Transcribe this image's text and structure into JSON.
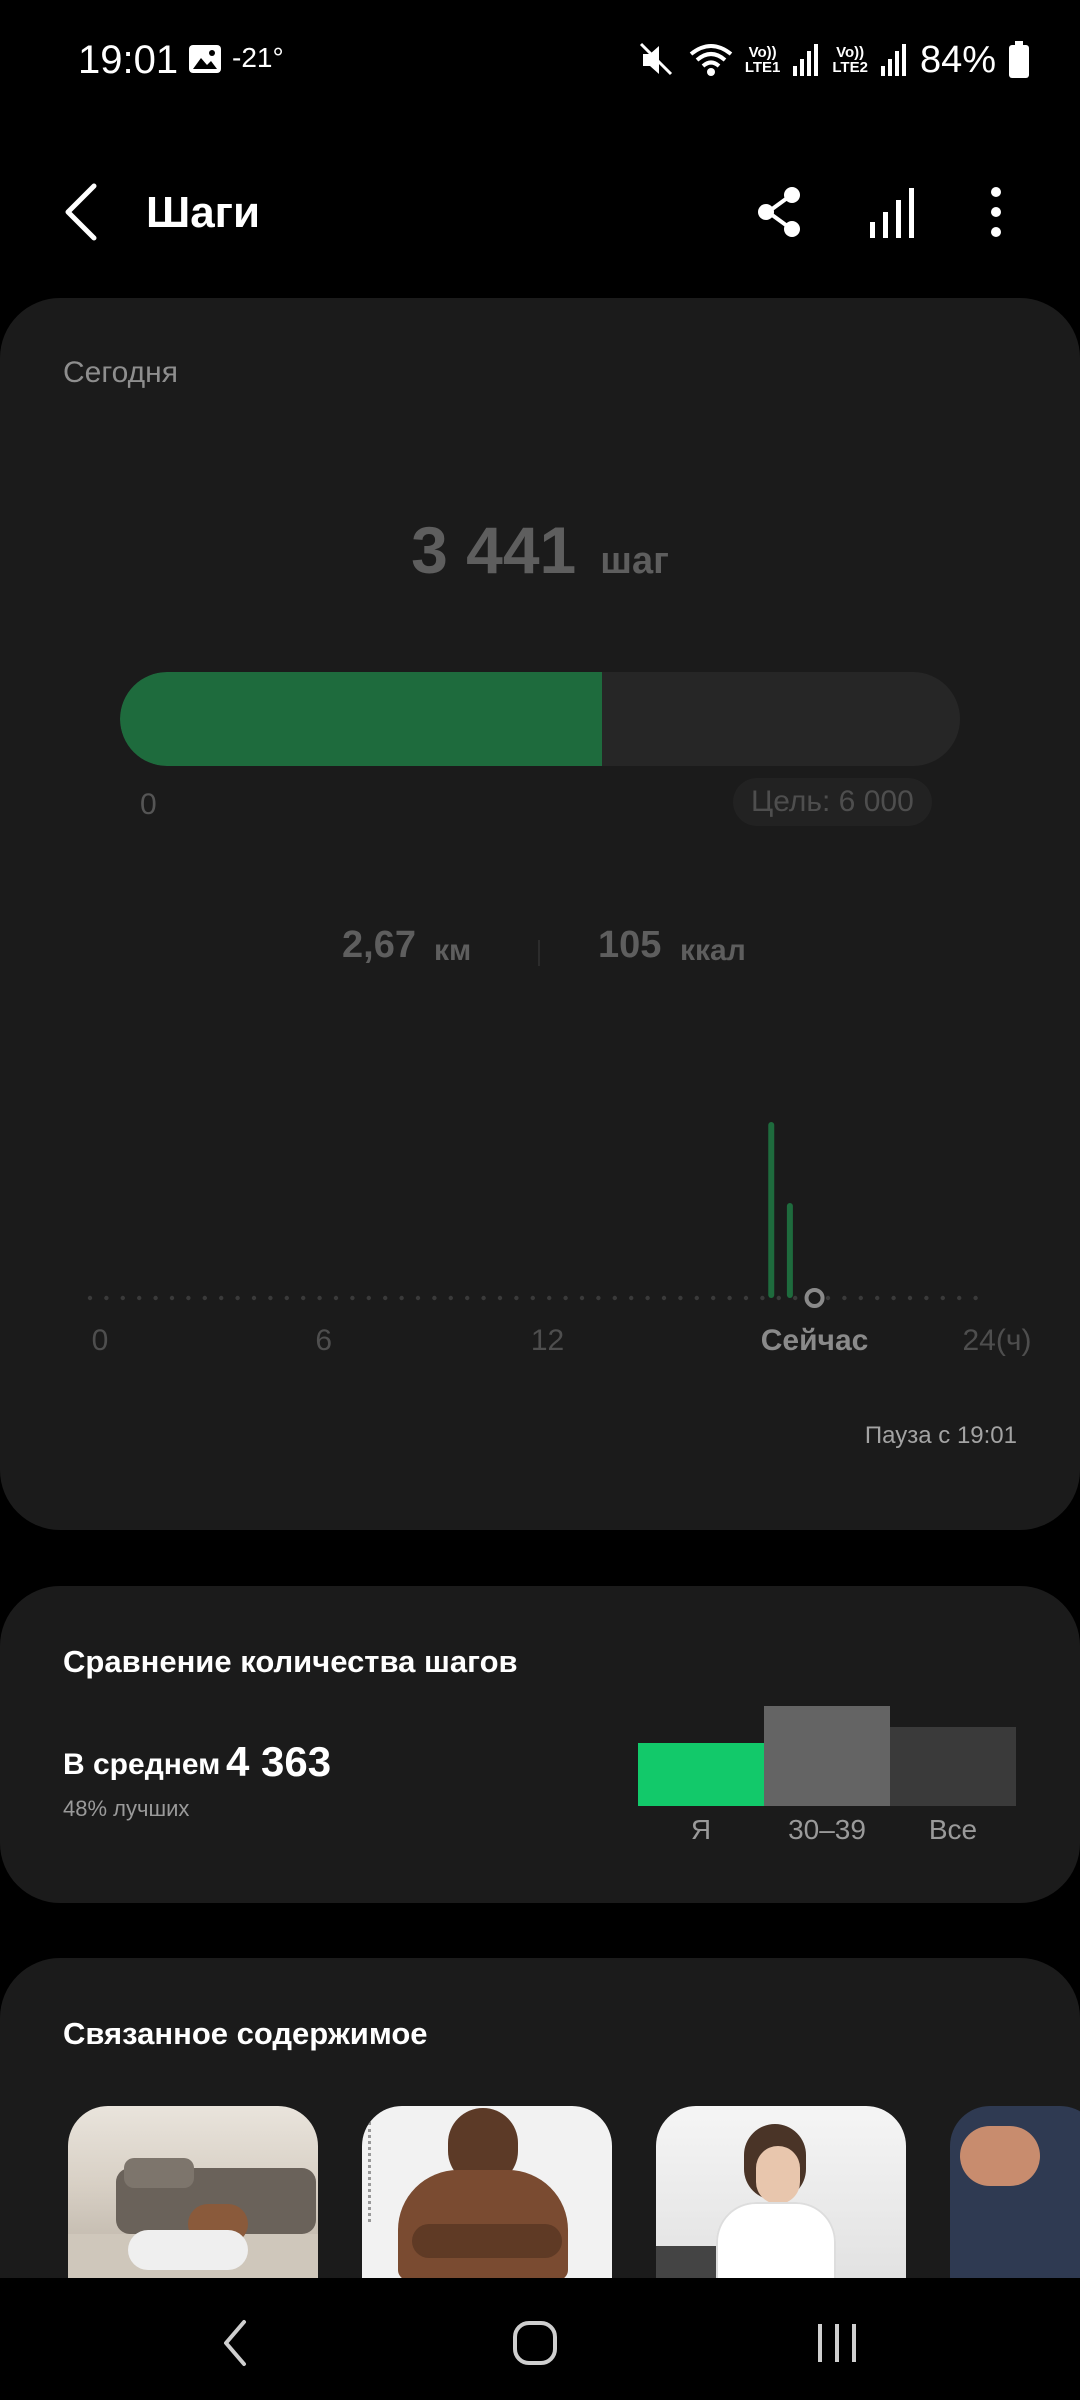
{
  "status_bar": {
    "time": "19:01",
    "temperature": "-21°",
    "sim1_volte": "Vo))",
    "sim1_lte": "LTE1",
    "sim2_volte": "Vo))",
    "sim2_lte": "LTE2",
    "battery": "84%"
  },
  "app_bar": {
    "title": "Шаги",
    "icons": [
      "back-icon",
      "share-icon",
      "chart-icon",
      "more-vertical-icon"
    ]
  },
  "today_card": {
    "label": "Сегодня",
    "steps": "3 441",
    "steps_unit": "шаг",
    "progress_fraction": 0.5735,
    "progress_min": "0",
    "goal": "Цель: 6 000",
    "distance_value": "2,67",
    "distance_unit": "км",
    "calories_value": "105",
    "calories_unit": "ккал",
    "hourly_axis": {
      "labels": [
        "0",
        "6",
        "12",
        "Сейчас",
        "24(ч)"
      ],
      "now_hour": 19.0
    },
    "hourly_bars": [
      {
        "hour": 18.0,
        "relative": 1.0
      },
      {
        "hour": 18.5,
        "relative": 0.54
      }
    ],
    "pause_text": "Пауза с 19:01",
    "colors": {
      "fill": "#1e6b3d",
      "bars": "#1e6b3d"
    }
  },
  "comparison_card": {
    "title": "Сравнение количества шагов",
    "average_label": "В среднем",
    "average_value": "4 363",
    "better_text": "48% лучших",
    "bars": [
      {
        "label": "Я",
        "value": 3441,
        "color": "#12c96a"
      },
      {
        "label": "30–39",
        "value": 5500,
        "color": "#646464"
      },
      {
        "label": "Все",
        "value": 4363,
        "color": "#3a3a3a"
      }
    ]
  },
  "related_card": {
    "title": "Связанное содержимое",
    "items": [
      "thumbnail-situps",
      "thumbnail-muscle-man",
      "thumbnail-woman-gym",
      "thumbnail-arm"
    ]
  },
  "nav_bar": {
    "icons": [
      "nav-back-icon",
      "nav-home-icon",
      "nav-recents-icon"
    ]
  }
}
